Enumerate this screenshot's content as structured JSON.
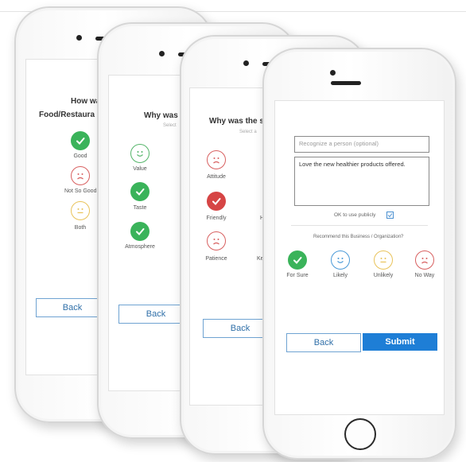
{
  "screens": [
    {
      "question": "How was",
      "question_line2": "Food/Restaura",
      "options": [
        {
          "label": "Good",
          "icon": "check-icon",
          "state": "selected",
          "color": "#3ab35a"
        },
        {
          "label": "Not So Good",
          "icon": "frown-face-icon",
          "state": "outline",
          "color": "#d86060"
        },
        {
          "label": "Both",
          "icon": "neutral-face-icon",
          "state": "outline",
          "color": "#e9c35a"
        }
      ],
      "back_label": "Back"
    },
    {
      "question": "Why was t",
      "subtitle": "Select",
      "options": [
        {
          "label": "Value",
          "icon": "smile-face-icon",
          "state": "outline",
          "color": "#55b56a"
        },
        {
          "label": "Taste",
          "icon": "check-icon",
          "state": "selected",
          "color": "#3ab35a"
        },
        {
          "label": "Atmosphere",
          "icon": "check-icon",
          "state": "selected",
          "color": "#3ab35a"
        }
      ],
      "back_label": "Back"
    },
    {
      "question": "Why was the s",
      "subtitle": "Select a",
      "options": [
        {
          "label": "Attitude",
          "icon": "frown-face-icon",
          "state": "outline",
          "color": "#d86060"
        },
        {
          "label": "Friendly",
          "icon": "check-icon",
          "state": "selected",
          "color": "#d64545"
        },
        {
          "label": "Patience",
          "icon": "frown-face-icon",
          "state": "outline",
          "color": "#d86060"
        }
      ],
      "partial_labels": [
        "H",
        "Ke"
      ],
      "back_label": "Back"
    },
    {
      "recognize_placeholder": "Recognize a person (optional)",
      "comment_value": "Love the new healthier products offered.",
      "publish_label": "OK to use publicly",
      "recommend_question": "Recommend this Business / Organization?",
      "options": [
        {
          "label": "For Sure",
          "icon": "check-icon",
          "state": "selected",
          "color": "#3ab35a"
        },
        {
          "label": "Likely",
          "icon": "smile-face-icon",
          "state": "outline",
          "color": "#4a9ad8"
        },
        {
          "label": "Unlikely",
          "icon": "neutral-face-icon",
          "state": "outline",
          "color": "#e9c35a"
        },
        {
          "label": "No Way",
          "icon": "frown-face-icon",
          "state": "outline",
          "color": "#d86060"
        }
      ],
      "back_label": "Back",
      "submit_label": "Submit"
    }
  ]
}
